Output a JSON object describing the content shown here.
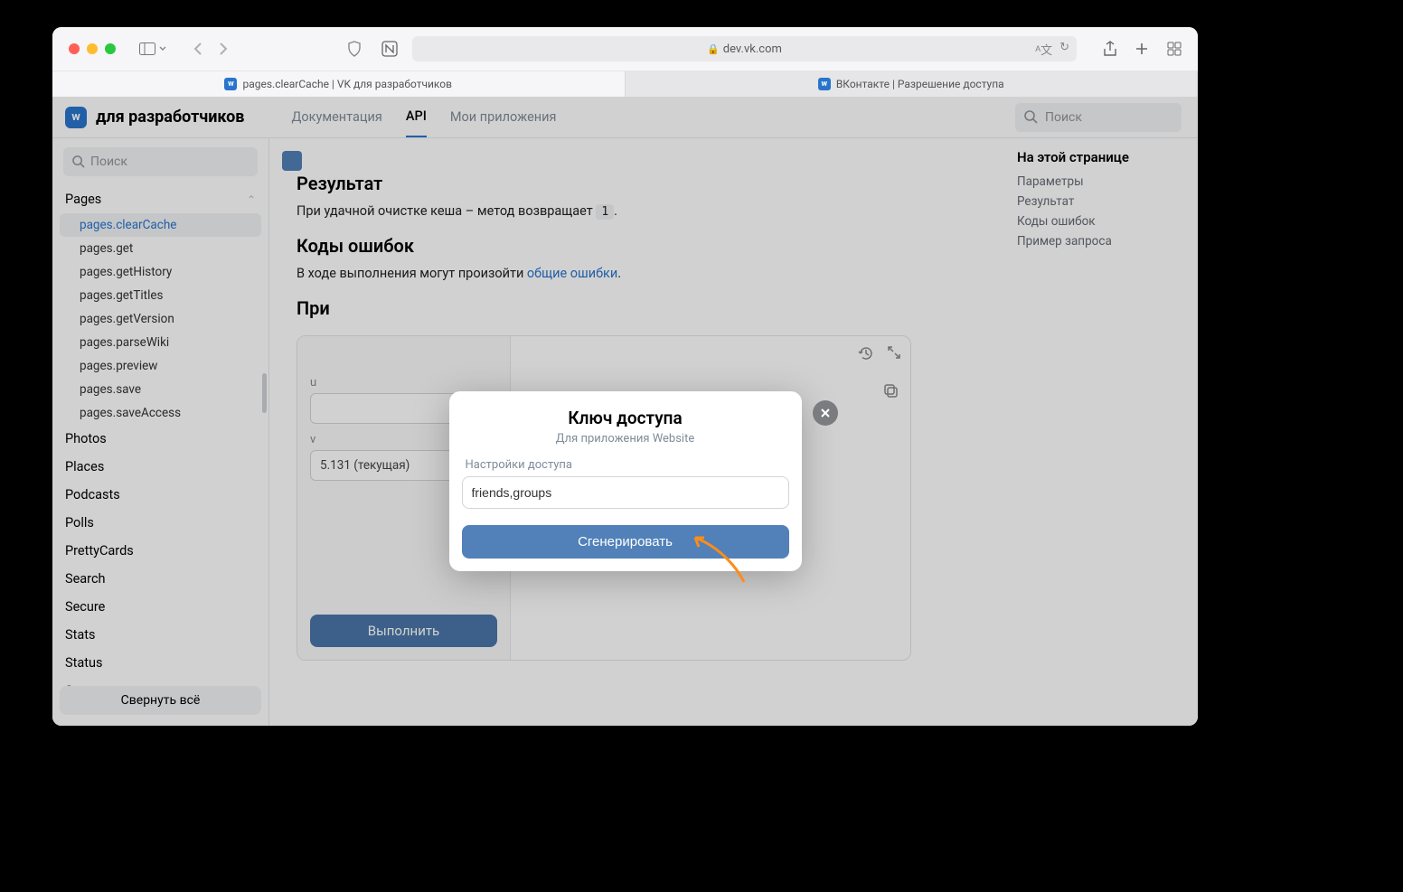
{
  "browser": {
    "url_host": "dev.vk.com",
    "tabs": [
      {
        "title": "pages.clearCache | VK для разработчиков",
        "active": true
      },
      {
        "title": "ВКонтакте | Разрешение доступа",
        "active": false
      }
    ]
  },
  "header": {
    "brand": "для разработчиков",
    "tabs": {
      "docs": "Документация",
      "api": "API",
      "apps": "Мои приложения"
    },
    "search_placeholder": "Поиск"
  },
  "sidebar": {
    "search_placeholder": "Поиск",
    "group_open": "Pages",
    "items": [
      "pages.clearCache",
      "pages.get",
      "pages.getHistory",
      "pages.getTitles",
      "pages.getVersion",
      "pages.parseWiki",
      "pages.preview",
      "pages.save",
      "pages.saveAccess"
    ],
    "groups": [
      "Photos",
      "Places",
      "Podcasts",
      "Polls",
      "PrettyCards",
      "Search",
      "Secure",
      "Stats",
      "Status",
      "Store"
    ],
    "collapse_all": "Свернуть всё"
  },
  "content": {
    "h_result": "Результат",
    "result_text_pre": "При удачной очистке кеша – метод возвращает ",
    "result_code": "1",
    "result_text_post": ".",
    "h_errors": "Коды ошибок",
    "errors_text_pre": "В ходе выполнения могут произойти ",
    "errors_link": "общие ошибки",
    "errors_text_post": ".",
    "h_example_cut": "При",
    "try": {
      "version_label": "v",
      "version_value": "5.131 (текущая)",
      "url_label": "u",
      "run": "Выполнить"
    }
  },
  "toc": {
    "title": "На этой странице",
    "items": [
      "Параметры",
      "Результат",
      "Коды ошибок",
      "Пример запроса"
    ]
  },
  "modal": {
    "title": "Ключ доступа",
    "subtitle": "Для приложения Website",
    "settings_label": "Настройки доступа",
    "input_value": "friends,groups",
    "generate": "Сгенерировать"
  }
}
